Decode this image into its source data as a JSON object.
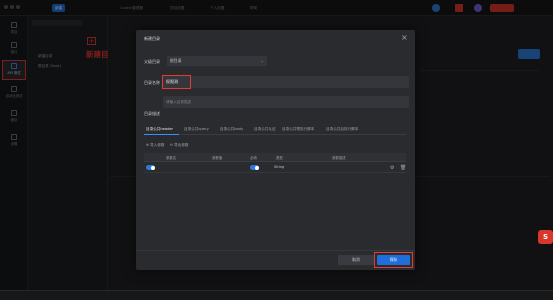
{
  "topbar": {
    "tabs": [
      "Cookie管理器",
      "项目设置",
      "个人设置",
      "帮助"
    ],
    "action_label": "新建"
  },
  "leftnav": {
    "items": [
      "项目",
      "接口",
      "API 测试",
      "自动化测试",
      "团队",
      "设置"
    ],
    "active_index": 2
  },
  "tree": {
    "rows": [
      "新建目录",
      "根目录 (Root)"
    ],
    "annotation": "新建目录"
  },
  "modal": {
    "title": "新建目录",
    "parent_label": "父级目录",
    "parent_value": "根目录",
    "name_label": "目录名称",
    "name_value": "权限测",
    "desc_placeholder": "请输入目录描述",
    "desc_label": "目录描述",
    "tabs": [
      "目录公共header",
      "目录公共query",
      "目录公共body",
      "目录公共认证",
      "目录公共预执行脚本",
      "目录公共后执行脚本"
    ],
    "active_tab": 0,
    "import_label": "导入参数",
    "export_label": "导出参数",
    "columns": [
      "参数名",
      "参数值",
      "必填",
      "类型",
      "参数描述"
    ],
    "row_type": "String",
    "cancel_label": "取消",
    "save_label": "保存"
  },
  "colors": {
    "accent": "#2f7ad8",
    "annotation_red": "#e53935"
  }
}
